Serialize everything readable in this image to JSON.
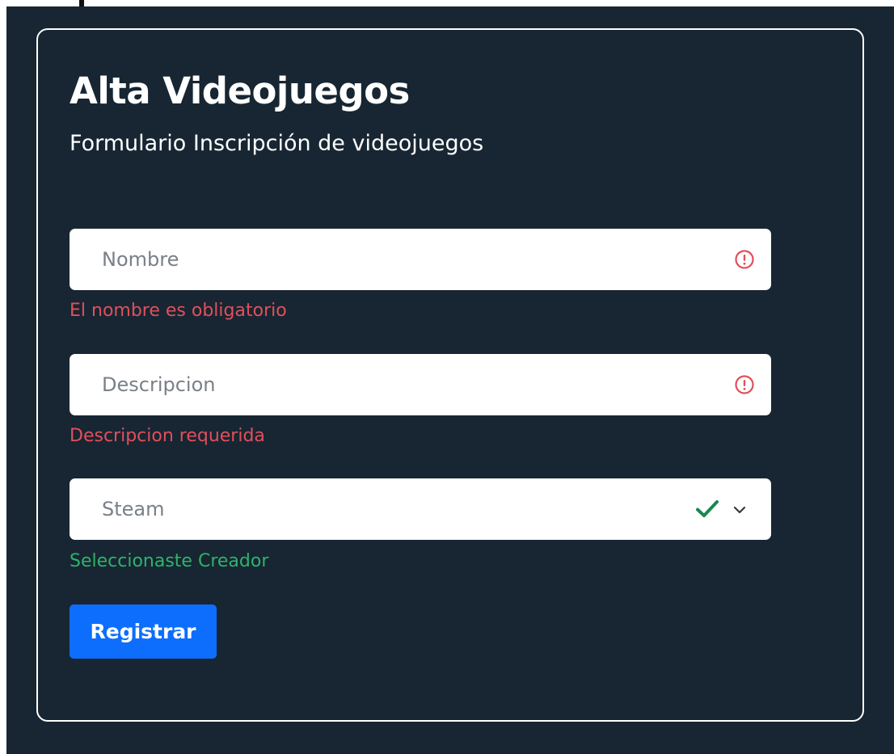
{
  "form": {
    "title": "Alta Videojuegos",
    "subtitle": "Formulario Inscripción de videojuegos",
    "fields": {
      "nombre": {
        "placeholder": "Nombre",
        "value": "",
        "feedback": "El nombre es obligatorio",
        "state": "invalid"
      },
      "descripcion": {
        "placeholder": "Descripcion",
        "value": "",
        "feedback": "Descripcion requerida",
        "state": "invalid"
      },
      "plataforma": {
        "selected": "Steam",
        "feedback": "Seleccionaste Creador",
        "state": "valid"
      }
    },
    "submit_label": "Registrar"
  },
  "colors": {
    "background": "#172632",
    "card_border": "#ffffff",
    "error": "#e0505c",
    "valid": "#2fb36a",
    "button": "#0d6efd"
  },
  "icons": {
    "invalid": "exclamation-circle-icon",
    "valid": "check-icon",
    "dropdown": "chevron-down-icon"
  }
}
